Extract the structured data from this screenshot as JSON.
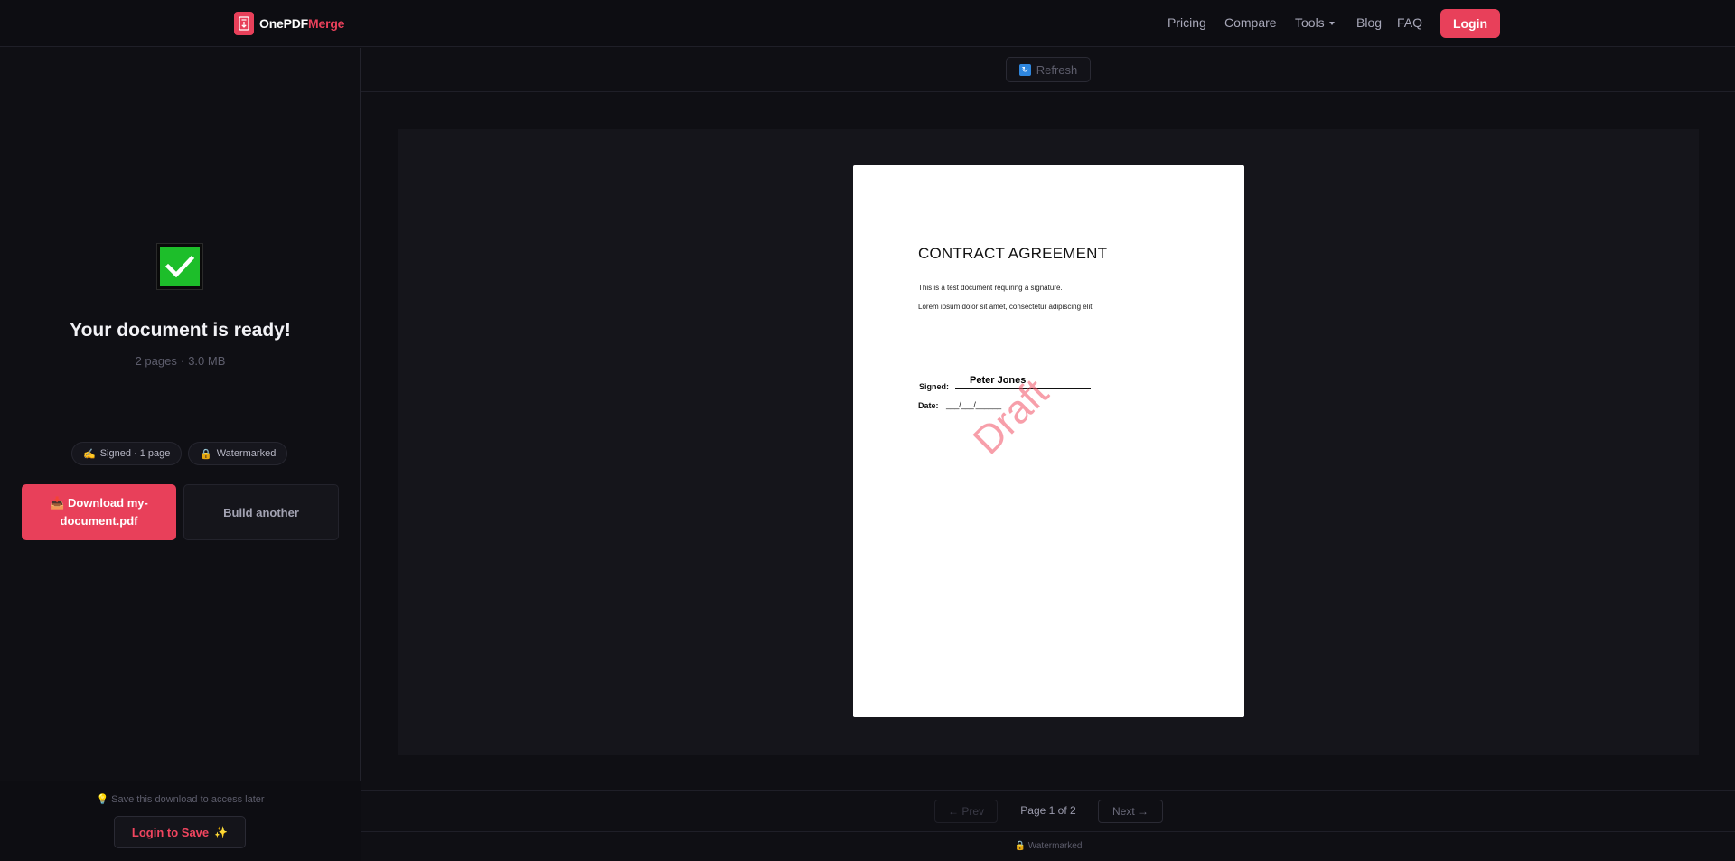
{
  "nav": {
    "brand_part1": "OnePDF",
    "brand_part2": "Merge",
    "links": [
      "Pricing",
      "Compare",
      "Tools",
      "Blog",
      "FAQ"
    ],
    "login_label": "Login",
    "accent_color": "#e8405a"
  },
  "sidebar": {
    "status_icon": "check-icon",
    "title": "Your document is ready!",
    "pages": "2 pages",
    "separator": "·",
    "size": "3.0 MB",
    "chips": [
      {
        "icon": "✍️",
        "label": "Signed · 1 page"
      },
      {
        "icon": "🔒",
        "label": "Watermarked"
      }
    ],
    "download_icon": "📥",
    "download_label": "Download my-document.pdf",
    "build_another_label": "Build another",
    "save_hint_icon": "💡",
    "save_hint": "Save this download to access later",
    "login_save_label": "Login to Save",
    "login_save_icon": "✨"
  },
  "toolbar": {
    "refresh_label": "Refresh"
  },
  "document": {
    "title": "CONTRACT AGREEMENT",
    "line1": "This is a test document requiring a signature.",
    "line2": "Lorem ipsum dolor sit amet, consectetur adipiscing elit.",
    "signed_label": "Signed:",
    "signature_name": "Peter Jones",
    "date_label": "Date:",
    "date_value": "___/___/______",
    "watermark": "Draft"
  },
  "pager": {
    "prev_label": "← Prev",
    "page_indicator": "Page 1 of 2",
    "next_label": "Next →"
  },
  "status": {
    "icon": "🔒",
    "label": "Watermarked"
  }
}
